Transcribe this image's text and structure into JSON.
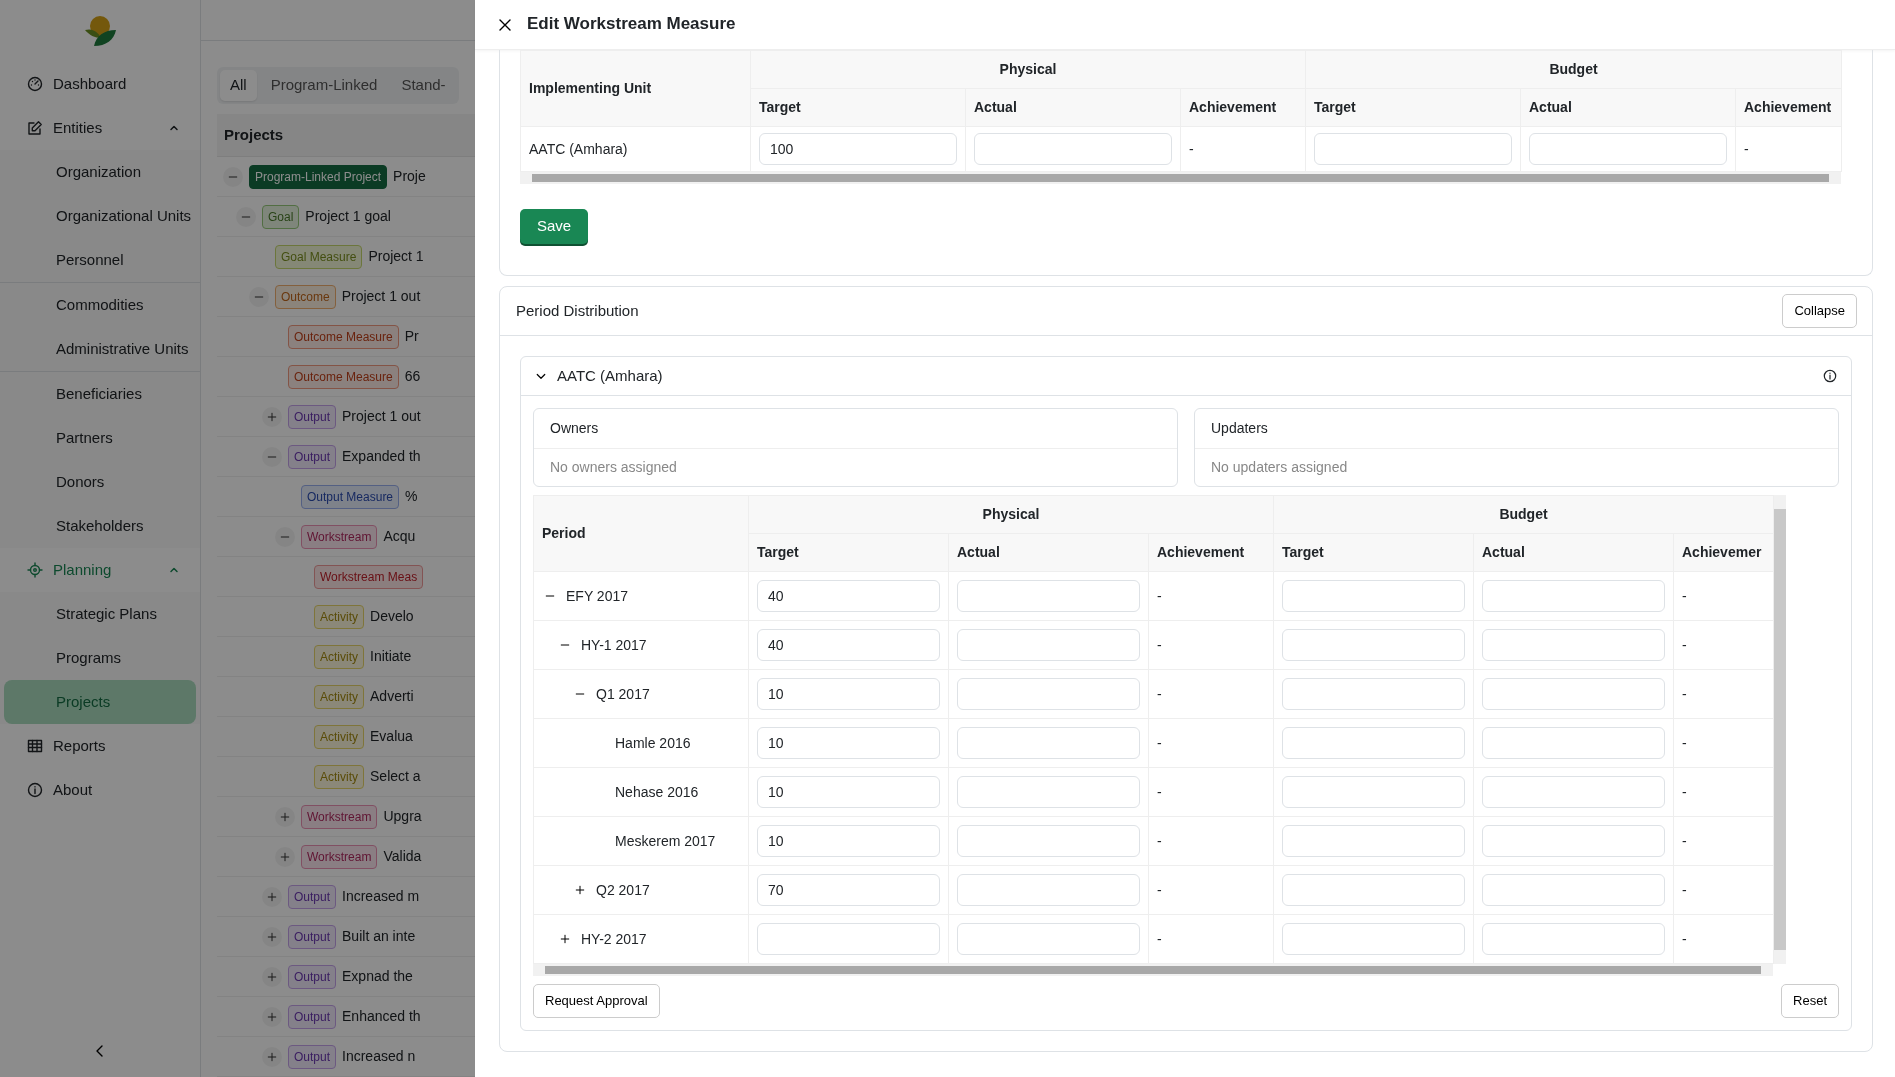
{
  "sidebar": {
    "items": [
      {
        "kind": "link",
        "label": "Dashboard",
        "selected": false
      },
      {
        "kind": "section",
        "label": "Entities",
        "selected": false,
        "expanded": true,
        "groups": [
          [
            {
              "label": "Organization",
              "selected": false
            },
            {
              "label": "Organizational Units",
              "selected": false
            },
            {
              "label": "Personnel",
              "selected": false
            }
          ],
          [
            {
              "label": "Commodities",
              "selected": false
            },
            {
              "label": "Administrative Units",
              "selected": false
            }
          ],
          [
            {
              "label": "Beneficiaries",
              "selected": false
            },
            {
              "label": "Partners",
              "selected": false
            },
            {
              "label": "Donors",
              "selected": false
            },
            {
              "label": "Stakeholders",
              "selected": false
            }
          ]
        ]
      },
      {
        "kind": "section",
        "label": "Planning",
        "selected": true,
        "expanded": true,
        "groups": [
          [
            {
              "label": "Strategic Plans",
              "selected": false
            },
            {
              "label": "Programs",
              "selected": false
            },
            {
              "label": "Projects",
              "selected": true
            }
          ]
        ]
      },
      {
        "kind": "link",
        "label": "Reports",
        "selected": false
      },
      {
        "kind": "link",
        "label": "About",
        "selected": false
      }
    ]
  },
  "main": {
    "tabs": [
      {
        "label": "All",
        "selected": true
      },
      {
        "label": "Program-Linked",
        "selected": false
      },
      {
        "label": "Stand-",
        "selected": false
      }
    ],
    "projects": {
      "title": "Projects",
      "tree": [
        {
          "kind": "program-linked-project",
          "badge": "Program-Linked Project",
          "text": "Proje",
          "expanded": true,
          "children": [
            {
              "kind": "goal",
              "badge": "Goal",
              "text": "Project 1 goal",
              "expanded": true,
              "children": [
                {
                  "kind": "goal-measure",
                  "badge": "Goal Measure",
                  "text": "Project 1"
                },
                {
                  "kind": "outcome",
                  "badge": "Outcome",
                  "text": "Project 1 out",
                  "expanded": true,
                  "children": [
                    {
                      "kind": "outcome-measure",
                      "badge": "Outcome Measure",
                      "text": "Pr"
                    },
                    {
                      "kind": "outcome-measure",
                      "badge": "Outcome Measure",
                      "text": "66"
                    },
                    {
                      "kind": "output",
                      "badge": "Output",
                      "text": "Project 1 out",
                      "expanded": false
                    },
                    {
                      "kind": "output",
                      "badge": "Output",
                      "text": "Expanded th",
                      "expanded": true,
                      "children": [
                        {
                          "kind": "output-measure",
                          "badge": "Output Measure",
                          "text": "%"
                        },
                        {
                          "kind": "workstream",
                          "badge": "Workstream",
                          "text": "Acqu",
                          "expanded": true,
                          "children": [
                            {
                              "kind": "workstream-measure",
                              "badge": "Workstream Meas"
                            },
                            {
                              "kind": "activity",
                              "badge": "Activity",
                              "text": "Develo"
                            },
                            {
                              "kind": "activity",
                              "badge": "Activity",
                              "text": "Initiate"
                            },
                            {
                              "kind": "activity",
                              "badge": "Activity",
                              "text": "Adverti"
                            },
                            {
                              "kind": "activity",
                              "badge": "Activity",
                              "text": "Evalua"
                            },
                            {
                              "kind": "activity",
                              "badge": "Activity",
                              "text": "Select a"
                            }
                          ]
                        },
                        {
                          "kind": "workstream",
                          "badge": "Workstream",
                          "text": "Upgra",
                          "expanded": false
                        },
                        {
                          "kind": "workstream",
                          "badge": "Workstream",
                          "text": "Valida",
                          "expanded": false
                        }
                      ]
                    },
                    {
                      "kind": "output",
                      "badge": "Output",
                      "text": "Increased m",
                      "expanded": false
                    },
                    {
                      "kind": "output",
                      "badge": "Output",
                      "text": "Built an inte",
                      "expanded": false
                    },
                    {
                      "kind": "output",
                      "badge": "Output",
                      "text": "Expnad the",
                      "expanded": false
                    },
                    {
                      "kind": "output",
                      "badge": "Output",
                      "text": "Enhanced th",
                      "expanded": false
                    },
                    {
                      "kind": "output",
                      "badge": "Output",
                      "text": "Increased n",
                      "expanded": false
                    }
                  ]
                }
              ]
            }
          ]
        }
      ]
    }
  },
  "dialog": {
    "title": "Edit Workstream Measure",
    "unit_table": {
      "first_column": "Implementing Unit",
      "groups": [
        {
          "label": "Physical",
          "columns": [
            "Target",
            "Actual",
            "Achievement"
          ]
        },
        {
          "label": "Budget",
          "columns": [
            "Target",
            "Actual",
            "Achievement"
          ]
        }
      ],
      "rows": [
        {
          "unit": "AATC (Amhara)",
          "cells": [
            {
              "kind": "input",
              "value": "100"
            },
            {
              "kind": "input"
            },
            {
              "kind": "text",
              "text": "-"
            },
            {
              "kind": "input"
            },
            {
              "kind": "input"
            },
            {
              "kind": "text",
              "text": "-"
            }
          ]
        }
      ]
    },
    "save_button": "Save",
    "period": {
      "title": "Period Distribution",
      "collapse_button": "Collapse",
      "units": [
        {
          "name": "AATC (Amhara)",
          "expanded": true,
          "owners": {
            "title": "Owners",
            "empty": "No owners assigned"
          },
          "updaters": {
            "title": "Updaters",
            "empty": "No updaters assigned"
          },
          "table": {
            "first_column": "Period",
            "groups": [
              {
                "label": "Physical",
                "columns": [
                  "Target",
                  "Actual",
                  "Achievement"
                ]
              },
              {
                "label": "Budget",
                "columns": [
                  "Target",
                  "Actual",
                  "Achievemer"
                ]
              }
            ],
            "rows": [
              {
                "label": "EFY 2017",
                "expanded": true,
                "cells": [
                  "40",
                  null,
                  "-",
                  null,
                  null,
                  "-"
                ],
                "children": [
                  {
                    "label": "HY-1 2017",
                    "expanded": true,
                    "cells": [
                      "40",
                      null,
                      "-",
                      null,
                      null,
                      "-"
                    ],
                    "children": [
                      {
                        "label": "Q1 2017",
                        "expanded": true,
                        "cells": [
                          "10",
                          null,
                          "-",
                          null,
                          null,
                          "-"
                        ],
                        "children": [
                          {
                            "label": "Hamle 2016",
                            "cells": [
                              "10",
                              null,
                              "-",
                              null,
                              null,
                              "-"
                            ]
                          },
                          {
                            "label": "Nehase 2016",
                            "cells": [
                              "10",
                              null,
                              "-",
                              null,
                              null,
                              "-"
                            ]
                          },
                          {
                            "label": "Meskerem 2017",
                            "cells": [
                              "10",
                              null,
                              "-",
                              null,
                              null,
                              "-"
                            ]
                          }
                        ]
                      },
                      {
                        "label": "Q2 2017",
                        "expanded": false,
                        "cells": [
                          "70",
                          null,
                          "-",
                          null,
                          null,
                          "-"
                        ]
                      }
                    ]
                  },
                  {
                    "label": "HY-2 2017",
                    "expanded": false,
                    "cells": [
                      null,
                      null,
                      "-",
                      null,
                      null,
                      "-"
                    ]
                  }
                ]
              }
            ]
          },
          "request_button": "Request Approval",
          "reset_button": "Reset"
        }
      ]
    }
  }
}
